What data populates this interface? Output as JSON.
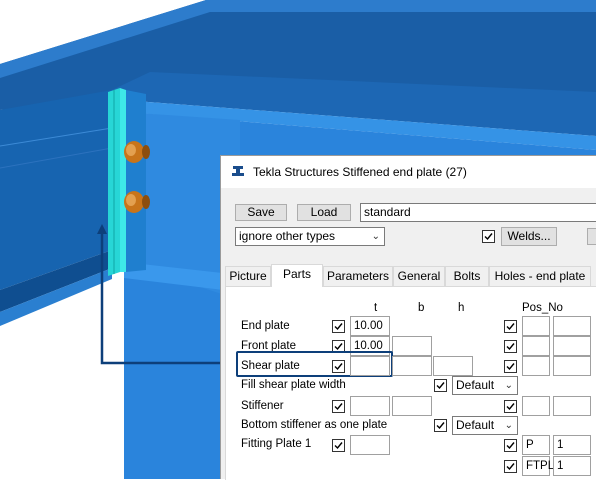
{
  "dialog": {
    "title": "Tekla Structures  Stiffened end plate (27)",
    "save_label": "Save",
    "load_label": "Load",
    "attribute_set": "standard",
    "type_option": "ignore other types",
    "welds_label": "Welds...",
    "welds_checked": true
  },
  "tabs": [
    {
      "label": "Picture",
      "active": false
    },
    {
      "label": "Parts",
      "active": true
    },
    {
      "label": "Parameters",
      "active": false
    },
    {
      "label": "General",
      "active": false
    },
    {
      "label": "Bolts",
      "active": false
    },
    {
      "label": "Holes - end plate",
      "active": false
    }
  ],
  "columns": {
    "t": "t",
    "b": "b",
    "h": "h",
    "pos_no": "Pos_No"
  },
  "rows": {
    "end_plate": {
      "label": "End plate",
      "t": "10.00",
      "b": "",
      "h": "",
      "checked": true,
      "pos_checked": true,
      "pos_prefix": "",
      "pos_start": ""
    },
    "front_plate": {
      "label": "Front plate",
      "t": "10.00",
      "b": "",
      "h": "",
      "checked": true,
      "pos_checked": true,
      "pos_prefix": "",
      "pos_start": ""
    },
    "shear_plate": {
      "label": "Shear plate",
      "t": "",
      "b": "",
      "h": "",
      "checked": true,
      "pos_checked": true,
      "pos_prefix": "",
      "pos_start": ""
    },
    "fill_shear_plate_width": {
      "label": "Fill shear plate width",
      "checked": true,
      "value": "Default"
    },
    "stiffener": {
      "label": "Stiffener",
      "t": "",
      "b": "",
      "checked": true,
      "pos_checked": true,
      "pos_prefix": "",
      "pos_start": ""
    },
    "bottom_stiffener": {
      "label": "Bottom stiffener as one plate",
      "checked": true,
      "value": "Default"
    },
    "fitting_plate_1": {
      "label": "Fitting Plate 1",
      "t": "",
      "checked": true,
      "pos_checked": true,
      "pos_prefix": "P",
      "pos_start": "1"
    },
    "fitting_extra": {
      "pos_checked": true,
      "pos_prefix": "FTPL",
      "pos_start": "1"
    }
  },
  "colors": {
    "beam": "#1f6fbf",
    "plate": "#2fe0e0",
    "bolt": "#c8741a",
    "highlight": "#0d3f7a"
  }
}
